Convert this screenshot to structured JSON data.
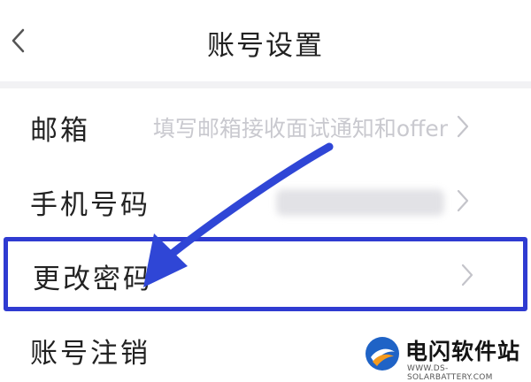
{
  "header": {
    "title": "账号设置",
    "back_icon": "chevron-left-icon"
  },
  "settings": {
    "items": [
      {
        "label": "邮箱",
        "value": "填写邮箱接收面试通知和offer"
      },
      {
        "label": "手机号码",
        "value": ""
      },
      {
        "label": "更改密码",
        "value": ""
      },
      {
        "label": "账号注销",
        "value": ""
      }
    ]
  },
  "annotation": {
    "highlight_color": "#2f3bd1",
    "arrow_color": "#2f46d6",
    "highlighted_item": "更改密码"
  },
  "watermark": {
    "name": "电闪软件站",
    "url": "WWW.DS-SOLARBATTERY.COM"
  }
}
